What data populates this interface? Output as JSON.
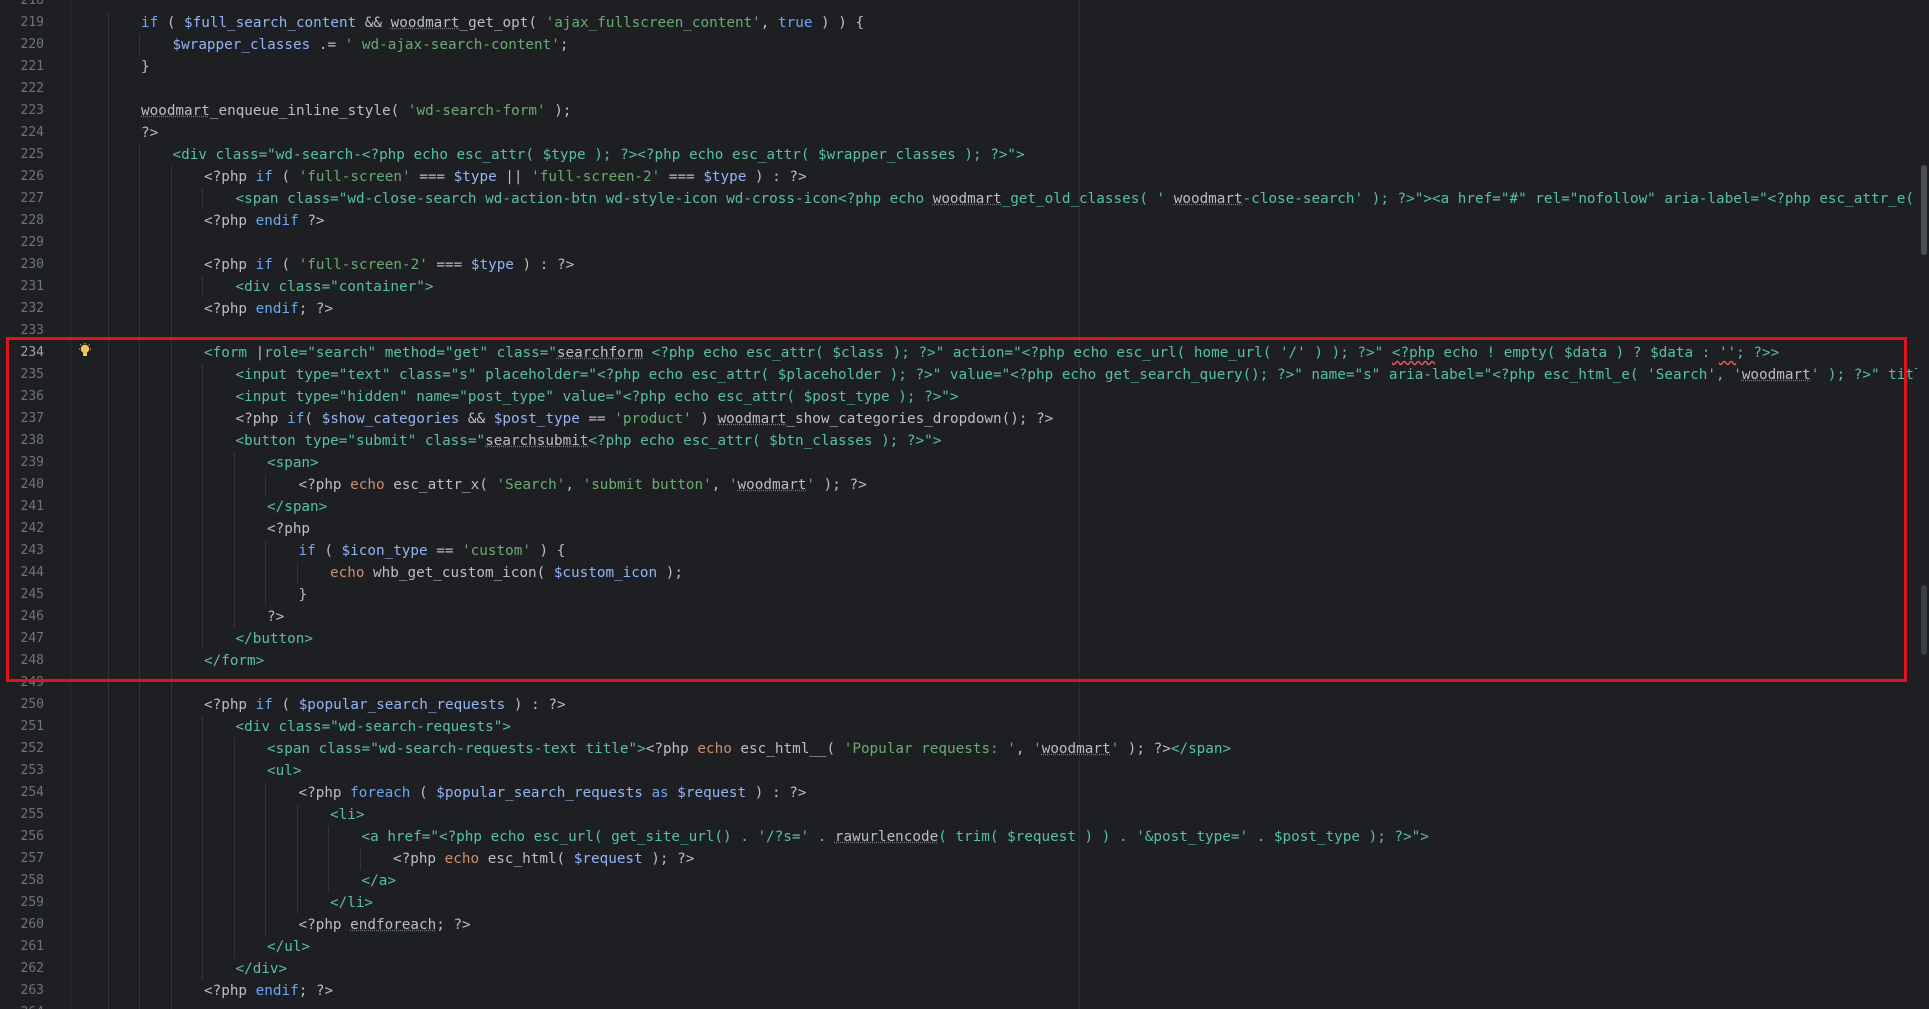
{
  "editor": {
    "current_line": "234",
    "highlight_color": "#e0141d",
    "lines": [
      {
        "n": "218",
        "indent": 0,
        "tokens": []
      },
      {
        "n": "219",
        "indent": 2,
        "tokens": [
          [
            "kb",
            "if"
          ],
          [
            "op",
            " ( "
          ],
          [
            "vv",
            "$full_search_content"
          ],
          [
            "op",
            " && "
          ],
          [
            "fn",
            "woodmart"
          ],
          [
            "op",
            "_get_opt( "
          ],
          [
            "st",
            "'ajax_fullscreen_content'"
          ],
          [
            "op",
            ", "
          ],
          [
            "kb",
            "true"
          ],
          [
            "op",
            " ) ) {"
          ]
        ]
      },
      {
        "n": "220",
        "indent": 3,
        "tokens": [
          [
            "vv",
            "$wrapper_classes"
          ],
          [
            "op",
            " .= "
          ],
          [
            "st",
            "' wd-ajax-search-content'"
          ],
          [
            "op",
            ";"
          ]
        ]
      },
      {
        "n": "221",
        "indent": 2,
        "tokens": [
          [
            "op",
            "}"
          ]
        ]
      },
      {
        "n": "222",
        "indent": 0,
        "tokens": []
      },
      {
        "n": "223",
        "indent": 2,
        "tokens": [
          [
            "fn",
            "woodmart"
          ],
          [
            "op",
            "_enqueue_inline_style( "
          ],
          [
            "st",
            "'wd-search-form'"
          ],
          [
            "op",
            " );"
          ]
        ]
      },
      {
        "n": "224",
        "indent": 2,
        "tokens": [
          [
            "ph",
            "?>"
          ]
        ]
      },
      {
        "n": "225",
        "indent": 3,
        "tokens": [
          [
            "tg",
            "<div class=\"wd-search-<?php echo esc_attr( $type ); ?><?php echo esc_attr( $wrapper_classes ); ?>\">"
          ]
        ]
      },
      {
        "n": "226",
        "indent": 4,
        "tokens": [
          [
            "ph",
            "<?php "
          ],
          [
            "kb",
            "if"
          ],
          [
            "op",
            " ( "
          ],
          [
            "st",
            "'full-screen'"
          ],
          [
            "op",
            " === "
          ],
          [
            "vv",
            "$type"
          ],
          [
            "op",
            " || "
          ],
          [
            "st",
            "'full-screen-2'"
          ],
          [
            "op",
            " === "
          ],
          [
            "vv",
            "$type"
          ],
          [
            "op",
            " ) : "
          ],
          [
            "ph",
            "?>"
          ]
        ]
      },
      {
        "n": "227",
        "indent": 5,
        "tokens": [
          [
            "tg",
            "<span class=\"wd-close-search wd-action-btn wd-style-icon wd-cross-icon<?php echo "
          ],
          [
            "fn",
            "woodmart"
          ],
          [
            "tg",
            "_get_old_classes( ' "
          ],
          [
            "fn",
            "woodmart"
          ],
          [
            "tg",
            "-close-search' ); ?>\"><a href=\"#\" rel=\"nofollow\" aria-label=\"<?php esc_attr_e( 'Close search form', '"
          ]
        ]
      },
      {
        "n": "228",
        "indent": 4,
        "tokens": [
          [
            "ph",
            "<?php "
          ],
          [
            "kb",
            "endif"
          ],
          [
            "op",
            " "
          ],
          [
            "ph",
            "?>"
          ]
        ]
      },
      {
        "n": "229",
        "indent": 0,
        "tokens": []
      },
      {
        "n": "230",
        "indent": 4,
        "tokens": [
          [
            "ph",
            "<?php "
          ],
          [
            "kb",
            "if"
          ],
          [
            "op",
            " ( "
          ],
          [
            "st",
            "'full-screen-2'"
          ],
          [
            "op",
            " === "
          ],
          [
            "vv",
            "$type"
          ],
          [
            "op",
            " ) : "
          ],
          [
            "ph",
            "?>"
          ]
        ]
      },
      {
        "n": "231",
        "indent": 5,
        "tokens": [
          [
            "tg",
            "<div class=\"container\">"
          ]
        ]
      },
      {
        "n": "232",
        "indent": 4,
        "tokens": [
          [
            "ph",
            "<?php "
          ],
          [
            "kb",
            "endif"
          ],
          [
            "op",
            "; "
          ],
          [
            "ph",
            "?>"
          ]
        ]
      },
      {
        "n": "233",
        "indent": 0,
        "tokens": []
      },
      {
        "n": "234",
        "indent": 4,
        "tokens": [
          [
            "tg",
            "<form "
          ],
          [
            "op",
            "|"
          ],
          [
            "tg",
            "role=\"search\" method=\"get\" class=\""
          ],
          [
            "fn",
            "searchform"
          ],
          [
            "tg",
            " <?php echo esc_attr( $class ); ?>\" action=\"<?php echo esc_url( home_url( '/' ) ); ?>\" "
          ],
          [
            "sqr",
            "<?php"
          ],
          [
            "tg",
            " echo ! empty( $data ) ? $data : "
          ],
          [
            "sqr",
            "''"
          ],
          [
            "tg",
            "; ?>>"
          ]
        ]
      },
      {
        "n": "235",
        "indent": 5,
        "tokens": [
          [
            "tg",
            "<input type=\"text\" class=\"s\" placeholder=\"<?php echo esc_attr( $placeholder ); ?>\" value=\"<?php echo get_search_query(); ?>\" name=\"s\" aria-label=\"<?php esc_html_e( 'Search', '"
          ],
          [
            "fn",
            "woodmart"
          ],
          [
            "tg",
            "' ); ?>\" title=\"<?php echo esc_attr"
          ]
        ]
      },
      {
        "n": "236",
        "indent": 5,
        "tokens": [
          [
            "tg",
            "<input type=\"hidden\" name=\"post_type\" value=\"<?php echo esc_attr( $post_type ); ?>\">"
          ]
        ]
      },
      {
        "n": "237",
        "indent": 5,
        "tokens": [
          [
            "ph",
            "<?php "
          ],
          [
            "kb",
            "if"
          ],
          [
            "op",
            "( "
          ],
          [
            "vv",
            "$show_categories"
          ],
          [
            "op",
            " && "
          ],
          [
            "vv",
            "$post_type"
          ],
          [
            "op",
            " == "
          ],
          [
            "st",
            "'product'"
          ],
          [
            "op",
            " ) "
          ],
          [
            "fn",
            "woodmart"
          ],
          [
            "op",
            "_show_categories_dropdown(); "
          ],
          [
            "ph",
            "?>"
          ]
        ]
      },
      {
        "n": "238",
        "indent": 5,
        "tokens": [
          [
            "tg",
            "<button type=\"submit\" class=\""
          ],
          [
            "fn",
            "searchsubmit"
          ],
          [
            "tg",
            "<?php echo esc_attr( $btn_classes ); ?>\">"
          ]
        ]
      },
      {
        "n": "239",
        "indent": 6,
        "tokens": [
          [
            "tg",
            "<span>"
          ]
        ]
      },
      {
        "n": "240",
        "indent": 7,
        "tokens": [
          [
            "ph",
            "<?php "
          ],
          [
            "kw",
            "echo"
          ],
          [
            "op",
            " esc_attr_x( "
          ],
          [
            "st",
            "'Search'"
          ],
          [
            "op",
            ", "
          ],
          [
            "st",
            "'submit button'"
          ],
          [
            "op",
            ", "
          ],
          [
            "st",
            "'"
          ],
          [
            "fn",
            "woodmart"
          ],
          [
            "st",
            "'"
          ],
          [
            "op",
            " ); "
          ],
          [
            "ph",
            "?>"
          ]
        ]
      },
      {
        "n": "241",
        "indent": 6,
        "tokens": [
          [
            "tg",
            "</span>"
          ]
        ]
      },
      {
        "n": "242",
        "indent": 6,
        "tokens": [
          [
            "ph",
            "<?php"
          ]
        ]
      },
      {
        "n": "243",
        "indent": 7,
        "tokens": [
          [
            "kb",
            "if"
          ],
          [
            "op",
            " ( "
          ],
          [
            "vv",
            "$icon_type"
          ],
          [
            "op",
            " == "
          ],
          [
            "st",
            "'custom'"
          ],
          [
            "op",
            " ) {"
          ]
        ]
      },
      {
        "n": "244",
        "indent": 8,
        "tokens": [
          [
            "kw",
            "echo"
          ],
          [
            "op",
            " whb_get_custom_icon( "
          ],
          [
            "vv",
            "$custom_icon"
          ],
          [
            "op",
            " );"
          ]
        ]
      },
      {
        "n": "245",
        "indent": 7,
        "tokens": [
          [
            "op",
            "}"
          ]
        ]
      },
      {
        "n": "246",
        "indent": 6,
        "tokens": [
          [
            "ph",
            "?>"
          ]
        ]
      },
      {
        "n": "247",
        "indent": 5,
        "tokens": [
          [
            "tg",
            "</button>"
          ]
        ]
      },
      {
        "n": "248",
        "indent": 4,
        "tokens": [
          [
            "tg",
            "</form>"
          ]
        ]
      },
      {
        "n": "249",
        "indent": 0,
        "tokens": []
      },
      {
        "n": "250",
        "indent": 4,
        "tokens": [
          [
            "ph",
            "<?php "
          ],
          [
            "kb",
            "if"
          ],
          [
            "op",
            " ( "
          ],
          [
            "vv",
            "$popular_search_requests"
          ],
          [
            "op",
            " ) : "
          ],
          [
            "ph",
            "?>"
          ]
        ]
      },
      {
        "n": "251",
        "indent": 5,
        "tokens": [
          [
            "tg",
            "<div class=\"wd-search-requests\">"
          ]
        ]
      },
      {
        "n": "252",
        "indent": 6,
        "tokens": [
          [
            "tg",
            "<span class=\"wd-search-requests-text title\">"
          ],
          [
            "ph",
            "<?php "
          ],
          [
            "kw",
            "echo"
          ],
          [
            "op",
            " esc_html__( "
          ],
          [
            "st",
            "'Popular requests: '"
          ],
          [
            "op",
            ", "
          ],
          [
            "st",
            "'"
          ],
          [
            "fn",
            "woodmart"
          ],
          [
            "st",
            "'"
          ],
          [
            "op",
            " ); "
          ],
          [
            "ph",
            "?>"
          ],
          [
            "tg",
            "</span>"
          ]
        ]
      },
      {
        "n": "253",
        "indent": 6,
        "tokens": [
          [
            "tg",
            "<ul>"
          ]
        ]
      },
      {
        "n": "254",
        "indent": 7,
        "tokens": [
          [
            "ph",
            "<?php "
          ],
          [
            "kb",
            "foreach"
          ],
          [
            "op",
            " ( "
          ],
          [
            "vv",
            "$popular_search_requests"
          ],
          [
            "op",
            " "
          ],
          [
            "kb",
            "as"
          ],
          [
            "op",
            " "
          ],
          [
            "vv",
            "$request"
          ],
          [
            "op",
            " ) : "
          ],
          [
            "ph",
            "?>"
          ]
        ]
      },
      {
        "n": "255",
        "indent": 8,
        "tokens": [
          [
            "tg",
            "<li>"
          ]
        ]
      },
      {
        "n": "256",
        "indent": 9,
        "tokens": [
          [
            "tg",
            "<a href=\"<?php echo esc_url( get_site_url() . '/?s=' . "
          ],
          [
            "fn",
            "rawurlencode"
          ],
          [
            "tg",
            "( trim( $request ) ) . '&post_type=' . $post_type ); ?>\">"
          ]
        ]
      },
      {
        "n": "257",
        "indent": 10,
        "tokens": [
          [
            "ph",
            "<?php "
          ],
          [
            "kw",
            "echo"
          ],
          [
            "op",
            " esc_html( "
          ],
          [
            "vv",
            "$request"
          ],
          [
            "op",
            " ); "
          ],
          [
            "ph",
            "?>"
          ]
        ]
      },
      {
        "n": "258",
        "indent": 9,
        "tokens": [
          [
            "tg",
            "</a>"
          ]
        ]
      },
      {
        "n": "259",
        "indent": 8,
        "tokens": [
          [
            "tg",
            "</li>"
          ]
        ]
      },
      {
        "n": "260",
        "indent": 7,
        "tokens": [
          [
            "ph",
            "<?php "
          ],
          [
            "fn",
            "endforeach"
          ],
          [
            "op",
            "; "
          ],
          [
            "ph",
            "?>"
          ]
        ]
      },
      {
        "n": "261",
        "indent": 6,
        "tokens": [
          [
            "tg",
            "</ul>"
          ]
        ]
      },
      {
        "n": "262",
        "indent": 5,
        "tokens": [
          [
            "tg",
            "</div>"
          ]
        ]
      },
      {
        "n": "263",
        "indent": 4,
        "tokens": [
          [
            "ph",
            "<?php "
          ],
          [
            "kb",
            "endif"
          ],
          [
            "op",
            "; "
          ],
          [
            "ph",
            "?>"
          ]
        ]
      },
      {
        "n": "264",
        "indent": 0,
        "tokens": []
      }
    ]
  }
}
